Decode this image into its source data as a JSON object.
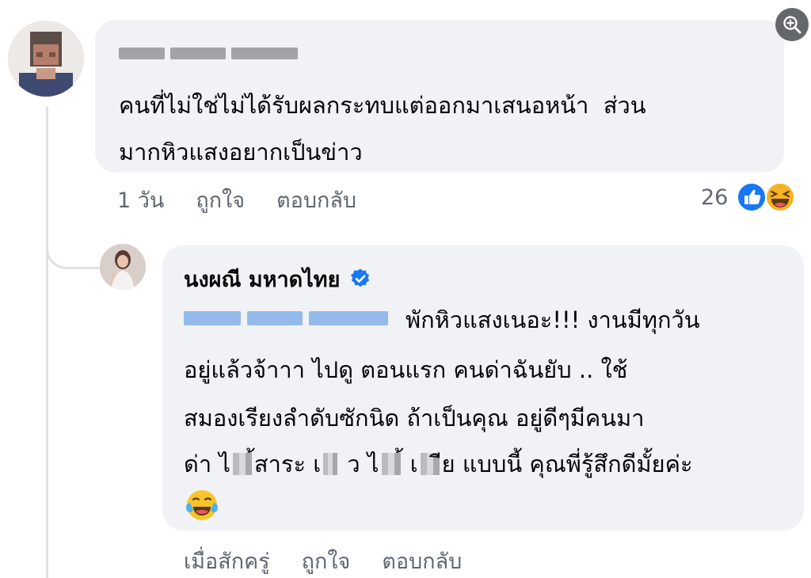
{
  "zoom": {
    "icon": "zoom-in-icon"
  },
  "comment1": {
    "text": "คนที่ไม่ใช่ไม่ได้รับผลกระทบแต่ออกมาเสนอหน้า  ส่วน\nมากหิวแสงอยากเป็นข่าว",
    "time": "1 วัน",
    "like_label": "ถูกใจ",
    "reply_label": "ตอบกลับ",
    "reaction_count": "26",
    "reactions": [
      "like-reaction-icon",
      "haha-reaction-icon"
    ]
  },
  "comment2": {
    "author": "นงผณี มหาดไทย",
    "line1": "พักหิวแสงเนอะ!!! งานมีทุกวัน",
    "line2": "อยู่แล้วจ้าาา ไปดู ตอนแรก คนด่าฉันยับ .. ใช้",
    "line3": "สมองเรียงลำดับซักนิด ถ้าเป็นคุณ อยู่ดีๆมีคนมา",
    "line4_a": "ด่า ไ",
    "line4_b": "้สาระ เ",
    "line4_c": " ว ไ",
    "line4_d": "้ เ",
    "line4_e": "ีย แบบนี้ คุณพี่รู้สึกดีมั้ยค่ะ",
    "time": "เมื่อสักครู่",
    "like_label": "ถูกใจ",
    "reply_label": "ตอบกลับ"
  },
  "colors": {
    "bubble": "#f0f2f5",
    "meta_text": "#606770",
    "like_blue": "#1877f2",
    "haha_yellow": "#f7b125"
  }
}
